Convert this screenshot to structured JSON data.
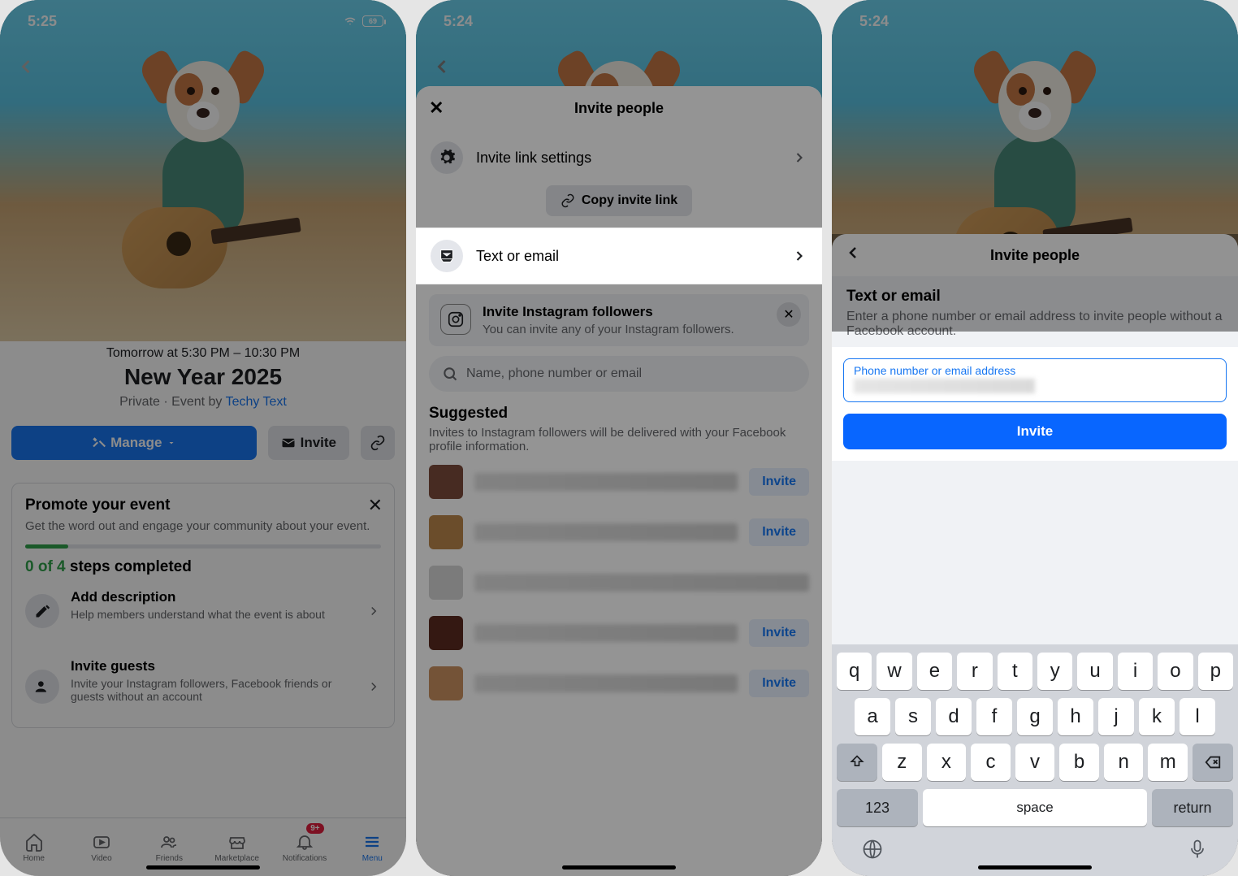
{
  "screen1": {
    "status": {
      "time": "5:25",
      "battery": "69"
    },
    "event": {
      "date_line": "Tomorrow at 5:30 PM – 10:30 PM",
      "title": "New Year 2025",
      "meta_prefix": "Private · Event by ",
      "meta_link": "Techy Text"
    },
    "buttons": {
      "manage": "Manage",
      "invite": "Invite"
    },
    "promote": {
      "title": "Promote your event",
      "subtitle": "Get the word out and engage your community about your event.",
      "steps_done": "0 of 4",
      "steps_suffix": " steps completed",
      "item1_title": "Add description",
      "item1_sub": "Help members understand what the event is about",
      "item2_title": "Invite guests",
      "item2_sub": "Invite your Instagram followers, Facebook friends or guests without an account"
    },
    "tabs": {
      "home": "Home",
      "video": "Video",
      "friends": "Friends",
      "marketplace": "Marketplace",
      "notifications": "Notifications",
      "menu": "Menu",
      "badge": "9+"
    }
  },
  "screen2": {
    "status": {
      "time": "5:24"
    },
    "sheet_title": "Invite people",
    "link_settings": "Invite link settings",
    "copy_link": "Copy invite link",
    "text_email": "Text or email",
    "ig_title": "Invite Instagram followers",
    "ig_sub": "You can invite any of your Instagram followers.",
    "search_placeholder": "Name, phone number or email",
    "suggested_title": "Suggested",
    "suggested_sub": "Invites to Instagram followers will be delivered with your Facebook profile information.",
    "invite_btn": "Invite",
    "avatars": [
      "#7a4a3c",
      "#b8864a",
      "#d4d4d4",
      "#5a2a20",
      "#c89060"
    ]
  },
  "screen3": {
    "status": {
      "time": "5:24"
    },
    "sheet_title": "Invite people",
    "section_title": "Text or email",
    "section_sub": "Enter a phone number or email address to invite people without a Facebook account.",
    "input_label": "Phone number or email address",
    "invite_btn": "Invite",
    "keys_r1": [
      "q",
      "w",
      "e",
      "r",
      "t",
      "y",
      "u",
      "i",
      "o",
      "p"
    ],
    "keys_r2": [
      "a",
      "s",
      "d",
      "f",
      "g",
      "h",
      "j",
      "k",
      "l"
    ],
    "keys_r3": [
      "z",
      "x",
      "c",
      "v",
      "b",
      "n",
      "m"
    ],
    "key_123": "123",
    "key_space": "space",
    "key_return": "return"
  }
}
